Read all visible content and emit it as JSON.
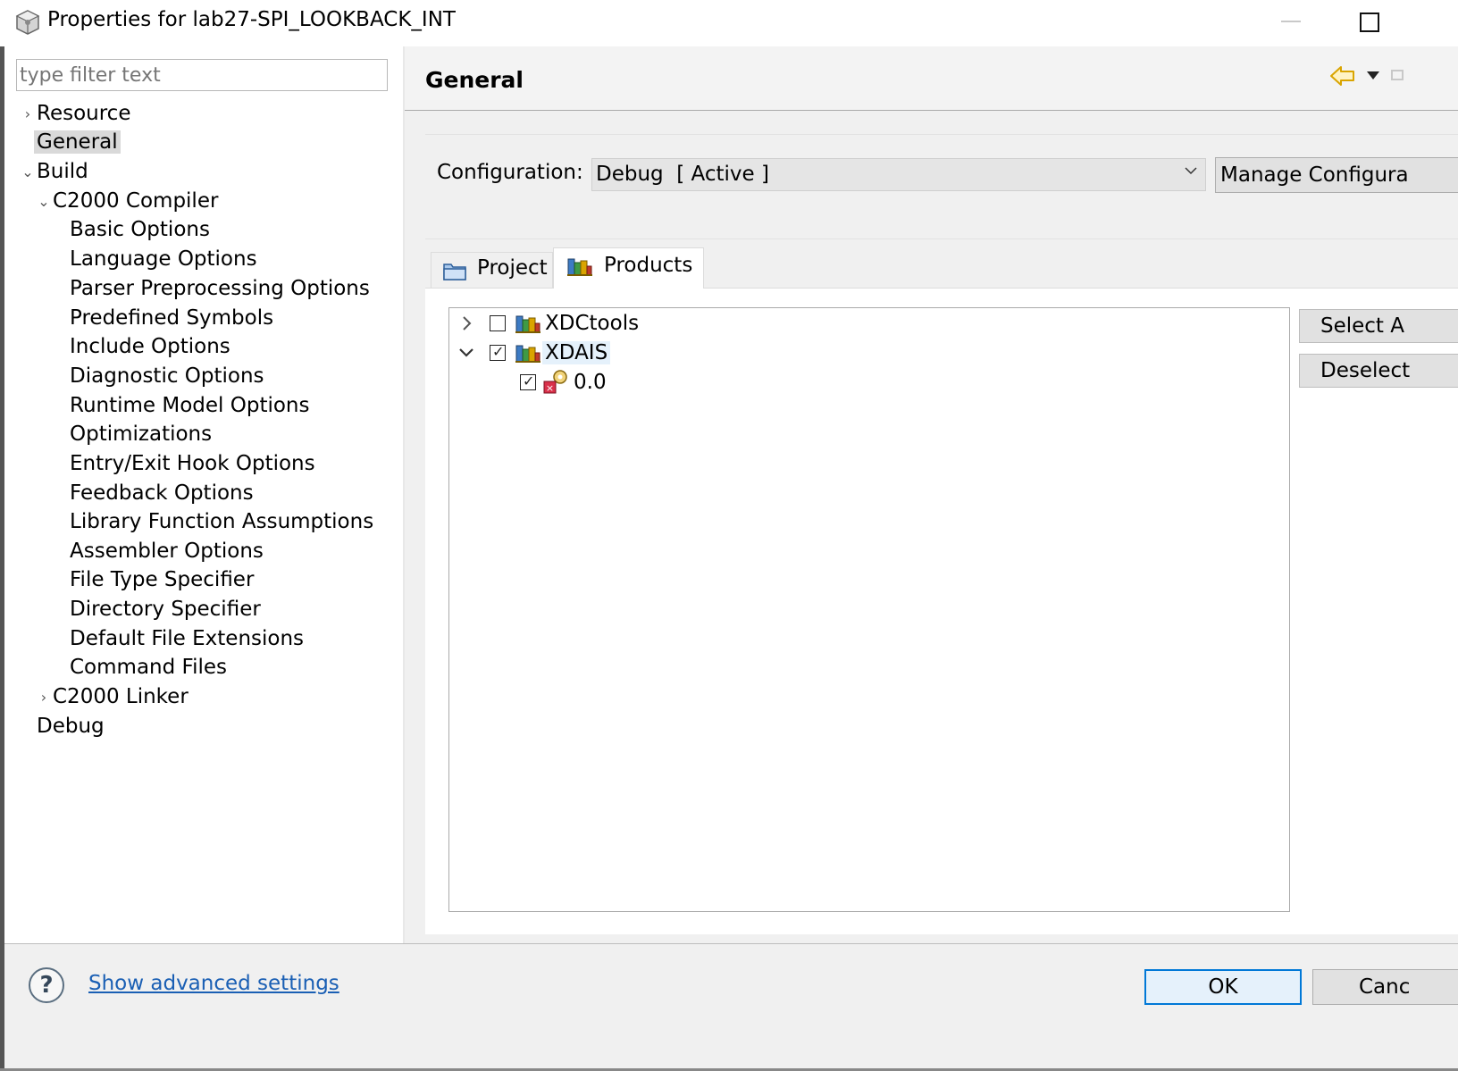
{
  "window": {
    "title": "Properties for lab27-SPI_LOOKBACK_INT"
  },
  "filter": {
    "placeholder": "type filter text"
  },
  "nav_tree": {
    "resource": "Resource",
    "general": "General",
    "build": "Build",
    "c2000_compiler": "C2000 Compiler",
    "compiler_children": [
      "Basic Options",
      "Language Options",
      "Parser Preprocessing Options",
      "Predefined Symbols",
      "Include Options",
      "Diagnostic Options",
      "Runtime Model Options",
      "Optimizations",
      "Entry/Exit Hook Options",
      "Feedback Options",
      "Library Function Assumptions",
      "Assembler Options",
      "File Type Specifier",
      "Directory Specifier",
      "Default File Extensions",
      "Command Files"
    ],
    "c2000_linker": "C2000 Linker",
    "debug": "Debug",
    "selected": "General"
  },
  "page": {
    "title": "General"
  },
  "configuration": {
    "label": "Configuration:",
    "value": "Debug  [ Active ]",
    "manage_button": "Manage Configura"
  },
  "tabs": {
    "project": "Project",
    "products": "Products",
    "active": "Products"
  },
  "products": {
    "items": [
      {
        "name": "XDCtools",
        "checked": false,
        "expanded": false
      },
      {
        "name": "XDAIS",
        "checked": true,
        "expanded": true,
        "children": [
          {
            "name": "0.0",
            "checked": true
          }
        ]
      }
    ],
    "select_all_button": "Select A",
    "deselect_all_button": "Deselect"
  },
  "footer": {
    "advanced_link": "Show advanced settings",
    "ok_button": "OK",
    "cancel_button": "Canc"
  },
  "colors": {
    "link": "#1a5fb4",
    "ok_border": "#0078d7",
    "selection": "#d9d9d9",
    "tree_highlight": "#e5f1fb"
  },
  "icons": {
    "app": "gear-cube-icon",
    "back": "back-arrow-icon",
    "help": "question-icon",
    "project_tab": "folder-icon",
    "products_tab": "books-icon",
    "version": "gear-version-icon"
  }
}
